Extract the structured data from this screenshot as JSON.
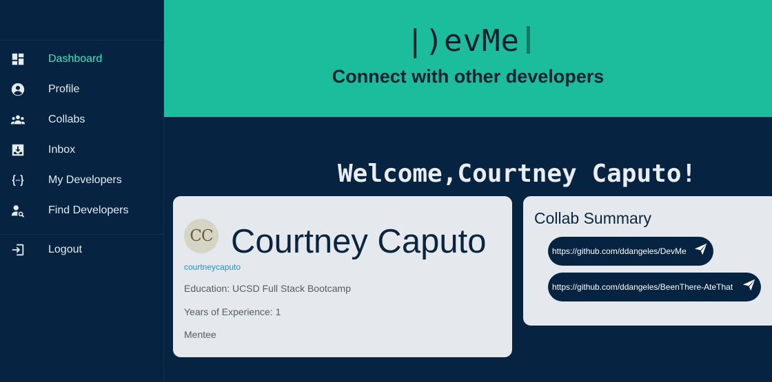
{
  "sidebar": {
    "items": [
      {
        "label": "Dashboard",
        "icon": "dashboard-icon",
        "active": true
      },
      {
        "label": "Profile",
        "icon": "profile-icon"
      },
      {
        "label": "Collabs",
        "icon": "group-icon"
      },
      {
        "label": "Inbox",
        "icon": "inbox-icon"
      },
      {
        "label": "My Developers",
        "icon": "code-braces-icon"
      },
      {
        "label": "Find Developers",
        "icon": "person-search-icon"
      }
    ],
    "logout": {
      "label": "Logout",
      "icon": "logout-icon"
    }
  },
  "header": {
    "logo": "|)evMe",
    "tagline": "Connect with other developers"
  },
  "welcome": "Welcome,Courtney Caputo!",
  "profile": {
    "initials": "CC",
    "name": "Courtney Caputo",
    "username": "courtneycaputo",
    "education": "Education: UCSD Full Stack Bootcamp",
    "experience": "Years of Experience: 1",
    "role": "Mentee"
  },
  "collab": {
    "title": "Collab Summary",
    "links": [
      {
        "url": "https://github.com/ddangeles/DevMe",
        "icon": "send-icon"
      },
      {
        "url": "https://github.com/ddangeles/BeenThere-AteThat",
        "icon": "send-icon"
      }
    ]
  },
  "colors": {
    "sidebar_bg": "#062441",
    "header_bg": "#1cbd9c",
    "active_nav": "#3ee8c0",
    "card_bg": "#e5e9ed",
    "link": "#1f8fc9"
  }
}
